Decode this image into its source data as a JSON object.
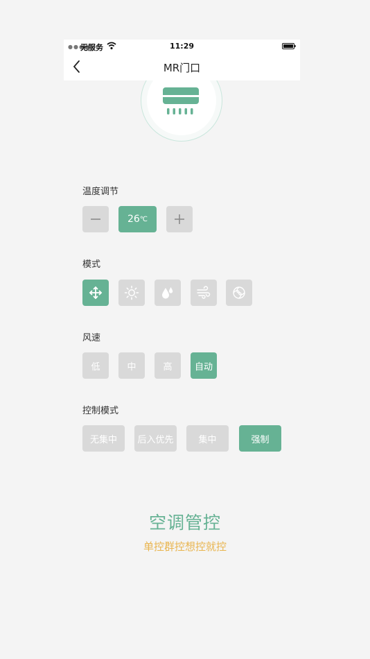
{
  "status_bar": {
    "carrier": "无服务",
    "time": "11:29",
    "icons": [
      "signal-dots-icon",
      "wifi-icon",
      "battery-icon"
    ]
  },
  "nav": {
    "title": "MR门口",
    "back_icon": "chevron-left-icon"
  },
  "device": {
    "icon": "air-conditioner-icon"
  },
  "temperature": {
    "label": "温度调节",
    "value": "26",
    "unit": "℃",
    "minus_icon": "minus-icon",
    "plus_icon": "plus-icon"
  },
  "mode": {
    "label": "模式",
    "items": [
      {
        "icon": "fan-cross-icon",
        "active": true
      },
      {
        "icon": "sun-icon",
        "active": false
      },
      {
        "icon": "water-drops-icon",
        "active": false
      },
      {
        "icon": "wind-icon",
        "active": false
      },
      {
        "icon": "swirl-icon",
        "active": false
      }
    ]
  },
  "fan_speed": {
    "label": "风速",
    "items": [
      {
        "label": "低",
        "active": false
      },
      {
        "label": "中",
        "active": false
      },
      {
        "label": "高",
        "active": false
      },
      {
        "label": "自动",
        "active": true
      }
    ]
  },
  "control_mode": {
    "label": "控制模式",
    "items": [
      {
        "label": "无集中",
        "active": false
      },
      {
        "label": "后入优先",
        "active": false
      },
      {
        "label": "集中",
        "active": false
      },
      {
        "label": "强制",
        "active": true
      }
    ]
  },
  "brand": {
    "title": "空调管控",
    "subtitle": "单控群控想控就控"
  },
  "colors": {
    "accent": "#66b294",
    "inactive": "#d9d9d9",
    "subtitle": "#e9b54f",
    "background": "#f4f4f4"
  }
}
